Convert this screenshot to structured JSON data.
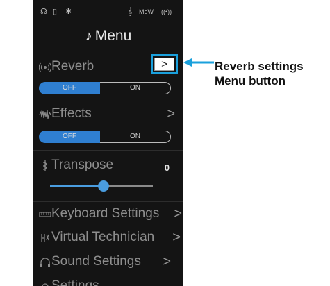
{
  "status": {
    "icons": [
      "headphone-icon",
      "usb-icon",
      "bluetooth-icon",
      "transpose-icon",
      "effects-icon",
      "reverb-icon"
    ],
    "headphone": "☊",
    "usb": "▯",
    "bluetooth": "✱",
    "transpose": "𝄞",
    "effects": "MoW",
    "reverb": "((•))"
  },
  "menu": {
    "title_glyph": "♪",
    "title": "Menu"
  },
  "rows": {
    "reverb": {
      "label": "Reverb",
      "chevron": ">"
    },
    "reverb_toggle": {
      "off": "OFF",
      "on": "ON"
    },
    "effects": {
      "label": "Effects",
      "chevron": ">"
    },
    "effects_toggle": {
      "off": "OFF",
      "on": "ON"
    },
    "transpose": {
      "label": "Transpose",
      "value": "0",
      "slider_fraction": 0.52
    },
    "keyboard_settings": {
      "label": "Keyboard Settings",
      "chevron": ">"
    },
    "virtual_technician": {
      "label": "Virtual Technician",
      "chevron": ">"
    },
    "sound_settings": {
      "label": "Sound Settings",
      "chevron": ">"
    },
    "settings": {
      "label": "Settings"
    }
  },
  "callout": {
    "button_glyph": ">",
    "line1": "Reverb settings",
    "line2": "Menu button",
    "color": "#1aa0dc"
  },
  "colors": {
    "accent": "#2f7fd1",
    "slider": "#4a9de0"
  }
}
